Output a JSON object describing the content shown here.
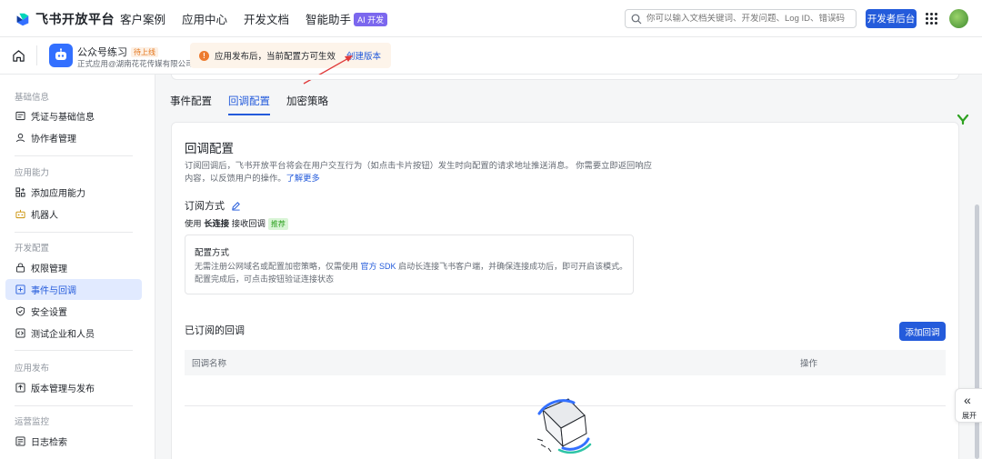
{
  "topnav": {
    "brand": "飞书开放平台",
    "links": [
      "客户案例",
      "应用中心",
      "开发文档",
      "智能助手"
    ],
    "ai_badge": "AI 开发",
    "search_placeholder": "你可以输入文档关键词、开发问题、Log ID、错误码",
    "dev_console": "开发者后台"
  },
  "subhead": {
    "app_name": "公众号练习",
    "app_status": "待上线",
    "app_sub": "正式应用@湖南花花传媒有限公司",
    "notice_text": "应用发布后，当前配置方可生效",
    "notice_link": "创建版本"
  },
  "sidebar": {
    "groups": [
      "基础信息",
      "应用能力",
      "开发配置",
      "应用发布",
      "运营监控"
    ],
    "items": [
      {
        "label": "凭证与基础信息",
        "icon": "credential-icon"
      },
      {
        "label": "协作者管理",
        "icon": "user-icon"
      },
      {
        "label": "添加应用能力",
        "icon": "apps-add-icon"
      },
      {
        "label": "机器人",
        "icon": "robot-icon"
      },
      {
        "label": "权限管理",
        "icon": "lock-icon"
      },
      {
        "label": "事件与回调",
        "icon": "event-icon"
      },
      {
        "label": "安全设置",
        "icon": "shield-icon"
      },
      {
        "label": "测试企业和人员",
        "icon": "code-icon"
      },
      {
        "label": "版本管理与发布",
        "icon": "upload-icon"
      },
      {
        "label": "日志检索",
        "icon": "log-icon"
      }
    ]
  },
  "tabs": [
    "事件配置",
    "回调配置",
    "加密策略"
  ],
  "card": {
    "title": "回调配置",
    "desc": "订阅回调后，飞书开放平台将会在用户交互行为（如点击卡片按钮）发生时向配置的请求地址推送消息。 你需要立即返回响应内容，以反馈用户的操作。",
    "desc_link": "了解更多",
    "sub_title": "订阅方式",
    "use_prefix": "使用",
    "use_bold": "长连接",
    "use_suffix": "接收回调",
    "recommend": "推荐",
    "config_title": "配置方式",
    "config_text_1": "无需注册公网域名或配置加密策略，仅需使用",
    "config_link": "官方 SDK",
    "config_text_2": "启动长连接飞书客户端，并确保连接成功后，即可开启该模式。",
    "config_text_3": "配置完成后，可点击按钮验证连接状态",
    "subscribed_title": "已订阅的回调",
    "add_button": "添加回调",
    "col_name": "回调名称",
    "col_op": "操作"
  },
  "expand": {
    "label": "展开"
  },
  "colors": {
    "primary": "#245bdb",
    "active_bg": "#e1eaff",
    "notice_bg": "#fdf4ea"
  }
}
